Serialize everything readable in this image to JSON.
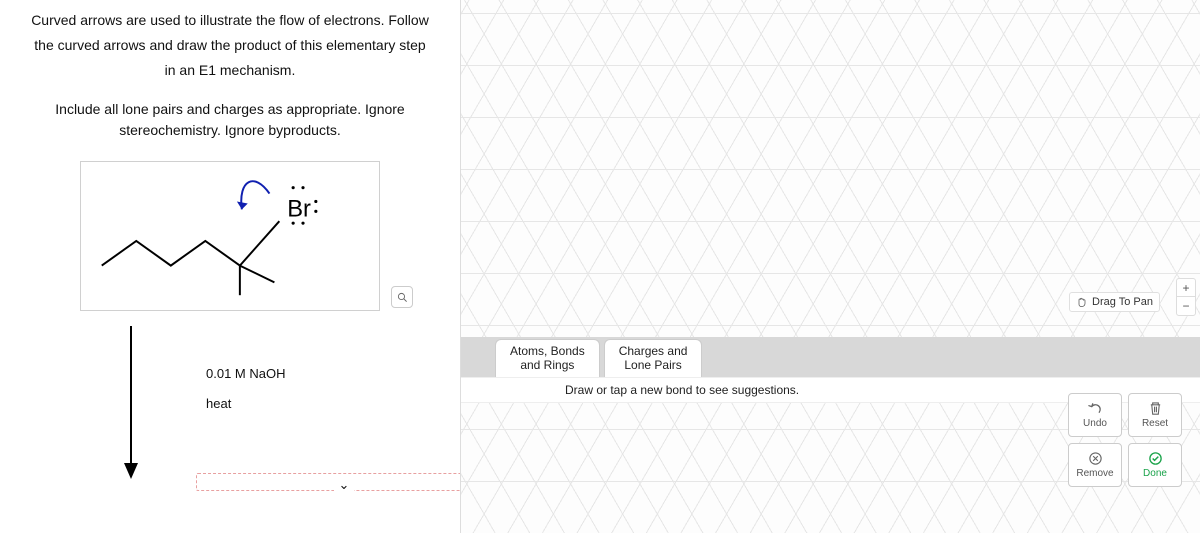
{
  "question": {
    "line1": "Curved arrows are used to illustrate the flow of electrons. Follow",
    "line2": "the curved arrows and draw the product of this elementary step",
    "line3": "in an E1 mechanism.",
    "sub1": "Include all lone pairs and charges as appropriate. Ignore",
    "sub2": "stereochemistry. Ignore byproducts."
  },
  "molecule": {
    "br_label": "Br"
  },
  "conditions": {
    "reagent": "0.01 M NaOH",
    "temp": "heat"
  },
  "tabs": {
    "t1_l1": "Atoms, Bonds",
    "t1_l2": "and Rings",
    "t2_l1": "Charges and",
    "t2_l2": "Lone Pairs"
  },
  "suggestion": "Draw or tap a new bond to see suggestions.",
  "drag_pan": "Drag To Pan",
  "controls": {
    "undo": "Undo",
    "reset": "Reset",
    "remove": "Remove",
    "done": "Done"
  }
}
